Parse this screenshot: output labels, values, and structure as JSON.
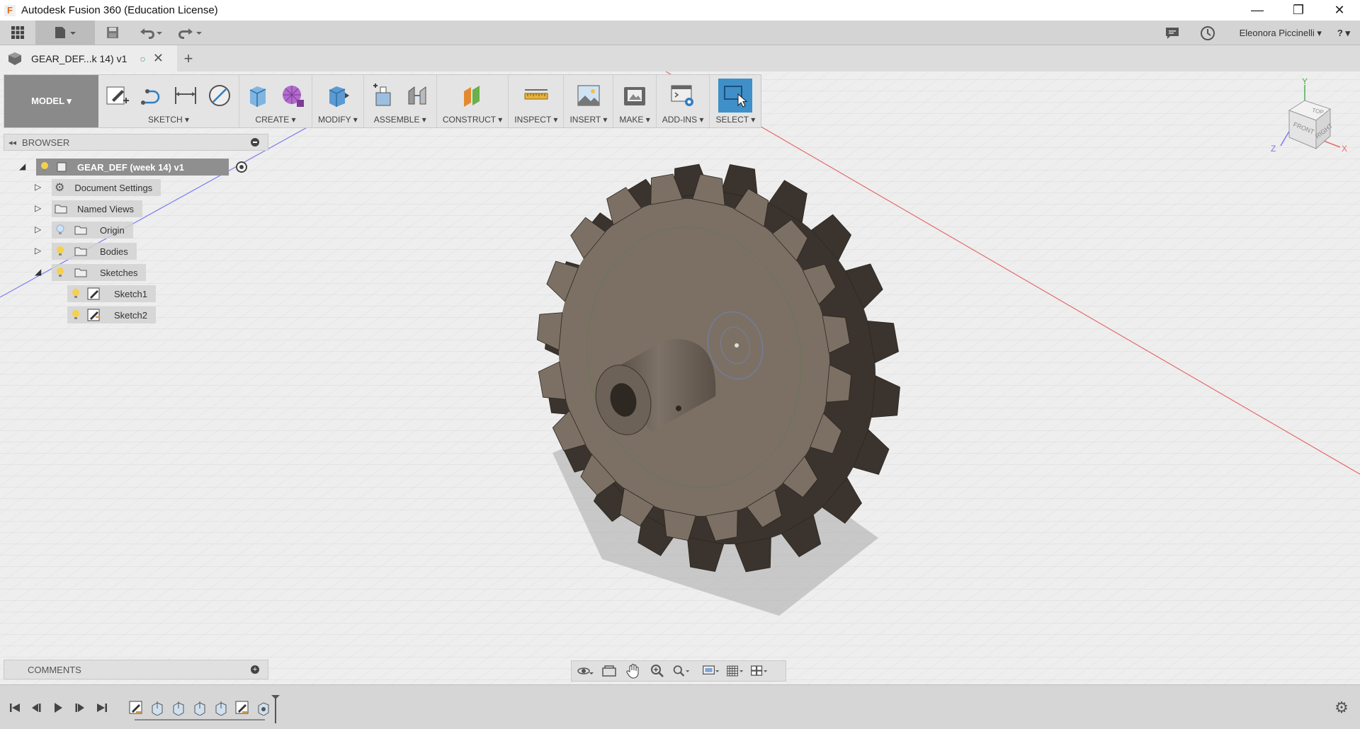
{
  "window": {
    "title": "Autodesk Fusion 360 (Education License)",
    "logo_letter": "F",
    "controls": {
      "minimize": "—",
      "restore": "❐",
      "close": "✕"
    }
  },
  "appbar": {
    "user": "Eleonora Piccinelli ▾",
    "help": "? ▾"
  },
  "tab": {
    "label": "GEAR_DEF...k 14) v1",
    "status_icon": "○",
    "close": "✕",
    "add": "+"
  },
  "ribbon": {
    "mode": "MODEL ▾",
    "groups": [
      {
        "label": "SKETCH ▾"
      },
      {
        "label": "CREATE ▾"
      },
      {
        "label": "MODIFY ▾"
      },
      {
        "label": "ASSEMBLE ▾"
      },
      {
        "label": "CONSTRUCT ▾"
      },
      {
        "label": "INSPECT ▾"
      },
      {
        "label": "INSERT ▾"
      },
      {
        "label": "MAKE ▾"
      },
      {
        "label": "ADD-INS ▾"
      },
      {
        "label": "SELECT ▾"
      }
    ]
  },
  "browser": {
    "title": "BROWSER",
    "root": "GEAR_DEF (week 14) v1",
    "items": [
      {
        "label": "Document Settings"
      },
      {
        "label": "Named Views"
      },
      {
        "label": "Origin"
      },
      {
        "label": "Bodies"
      },
      {
        "label": "Sketches"
      },
      {
        "label": "Sketch1"
      },
      {
        "label": "Sketch2"
      }
    ]
  },
  "comments": {
    "title": "COMMENTS"
  },
  "viewcube": {
    "top": "TOP",
    "front": "FRONT",
    "right": "RIGHT",
    "x": "X",
    "y": "Y",
    "z": "Z"
  },
  "colors": {
    "accent": "#3f8fc9",
    "gear": "#6b5f52",
    "gear_face": "#7c7064",
    "x_axis": "#e56b6b",
    "z_axis": "#6d6df0",
    "y_axis": "#4caf50"
  }
}
